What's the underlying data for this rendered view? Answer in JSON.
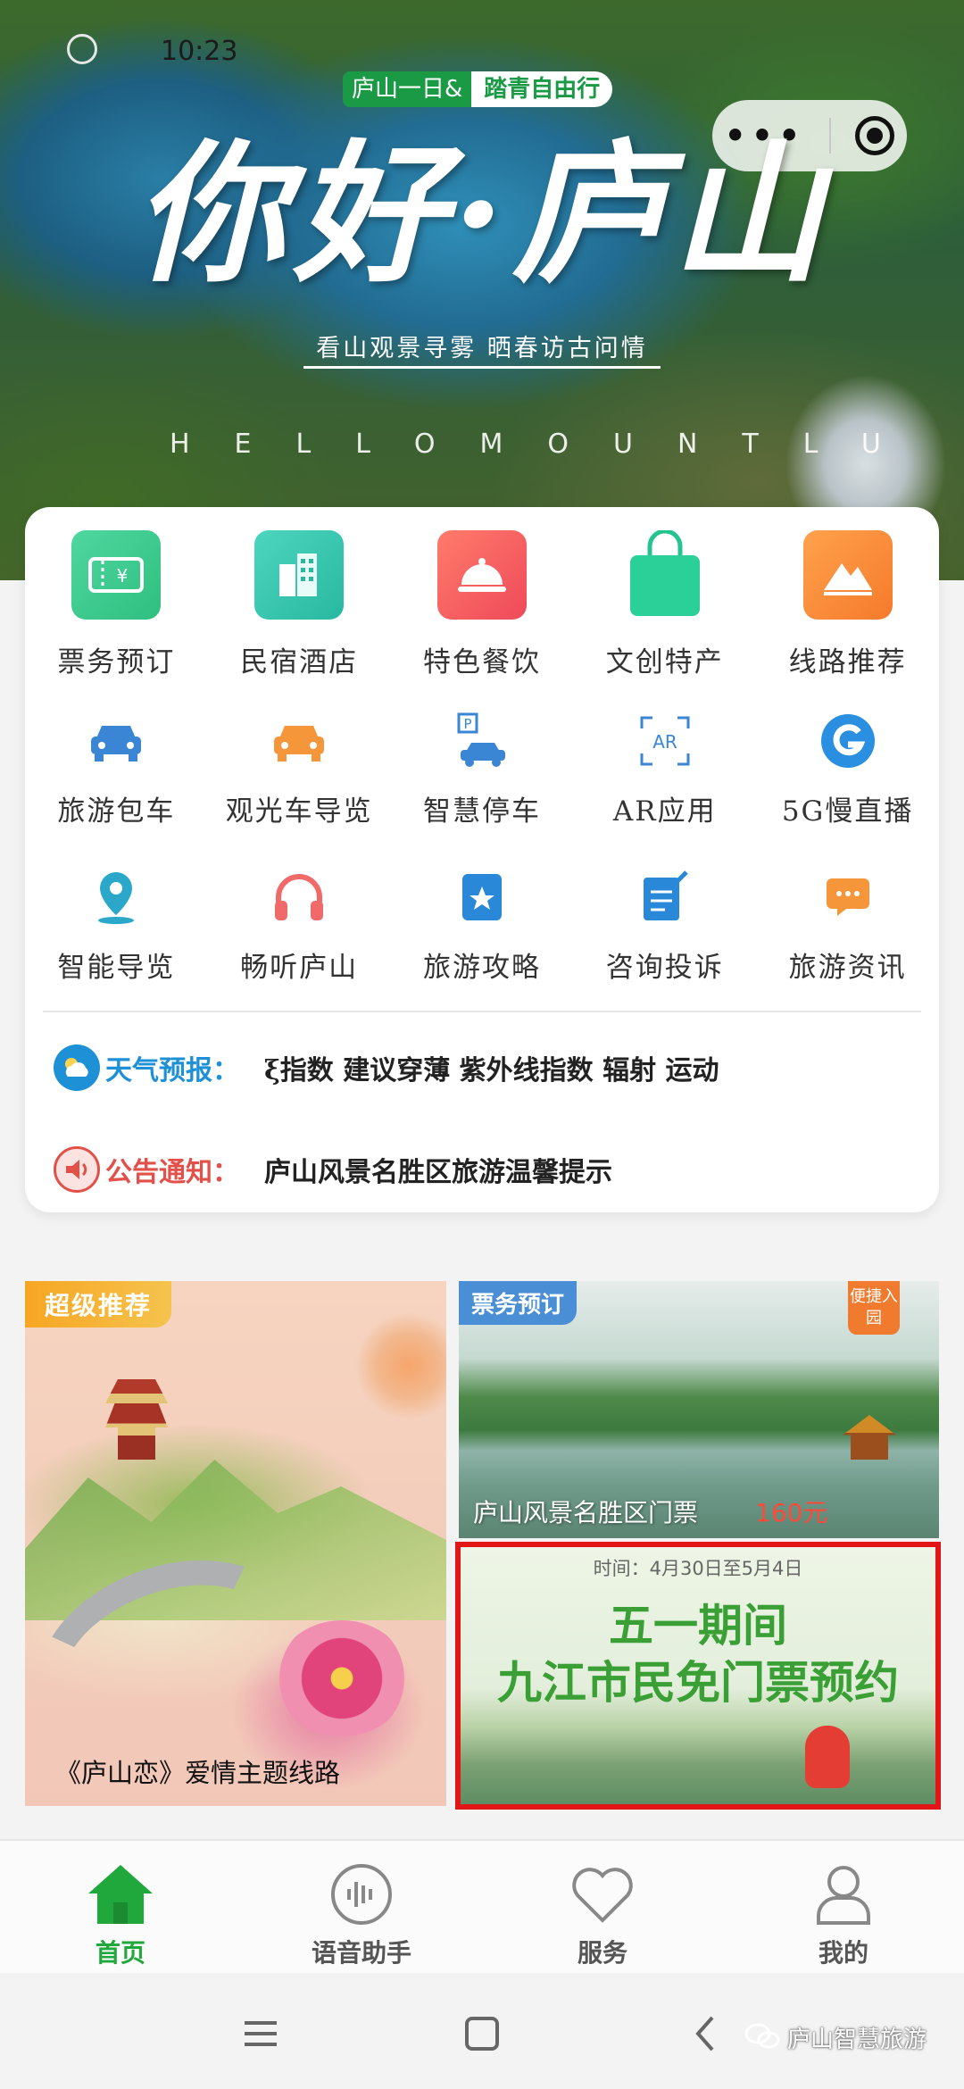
{
  "status_bar": {
    "time": "10:23"
  },
  "hero": {
    "tag_left": "庐山一日&",
    "tag_right": "踏青自由行",
    "title": "你好·庐山",
    "subtitle": "看山观景寻雾  晒春访古问情",
    "english": "HELLOMOUNTLU",
    "capsule": {
      "more_icon": "more-dots-icon",
      "close_icon": "target-close-icon"
    }
  },
  "menu": {
    "row1": [
      {
        "label": "票务预订",
        "icon": "ticket-icon",
        "color": "#35c88a"
      },
      {
        "label": "民宿酒店",
        "icon": "hotel-building-icon",
        "color": "#2ec4a6"
      },
      {
        "label": "特色餐饮",
        "icon": "dining-bell-icon",
        "color": "#f25b5b"
      },
      {
        "label": "文创特产",
        "icon": "shopping-bag-icon",
        "color": "#25c48e"
      },
      {
        "label": "线路推荐",
        "icon": "mountain-route-icon",
        "color": "#f78b3c"
      }
    ],
    "row2": [
      {
        "label": "旅游包车",
        "icon": "car-icon",
        "color": "#3a86d4"
      },
      {
        "label": "观光车导览",
        "icon": "tour-car-icon",
        "color": "#f5963b"
      },
      {
        "label": "智慧停车",
        "icon": "parking-icon",
        "color": "#3a86d4"
      },
      {
        "label": "AR应用",
        "icon": "ar-icon",
        "color": "#3a86d4"
      },
      {
        "label": "5G慢直播",
        "icon": "5g-icon",
        "color": "#2a8fe0"
      }
    ],
    "row3": [
      {
        "label": "智能导览",
        "icon": "location-pin-icon",
        "color": "#2aa7c9"
      },
      {
        "label": "畅听庐山",
        "icon": "headphones-icon",
        "color": "#f06a6a"
      },
      {
        "label": "旅游攻略",
        "icon": "guide-book-icon",
        "color": "#2a88d8"
      },
      {
        "label": "咨询投诉",
        "icon": "feedback-note-icon",
        "color": "#2a88d8"
      },
      {
        "label": "旅游资讯",
        "icon": "message-icon",
        "color": "#f5963b"
      }
    ]
  },
  "weather": {
    "label": "天气预报：",
    "text": "ξ指数  建议穿薄  紫外线指数  辐射    运动",
    "icon": "weather-cloud-icon",
    "color": "#1e90d6"
  },
  "notice": {
    "label": "公告通知：",
    "text": "庐山风景名胜区旅游温馨提示",
    "icon": "speaker-icon",
    "color": "#e2504a"
  },
  "promos": {
    "left": {
      "tag": "超级推荐",
      "caption": "《庐山恋》爱情主题线路"
    },
    "right_top": {
      "tag": "票务预订",
      "badge": "便捷入园",
      "name": "庐山风景名胜区门票",
      "price": "160元"
    },
    "right_bottom": {
      "date": "时间：4月30日至5月4日",
      "title_line1": "五一期间",
      "title_line2": "九江市民免门票预约"
    }
  },
  "tabbar": [
    {
      "label": "首页",
      "icon": "home-icon",
      "active": true
    },
    {
      "label": "语音助手",
      "icon": "voice-assistant-icon",
      "active": false
    },
    {
      "label": "服务",
      "icon": "heart-service-icon",
      "active": false
    },
    {
      "label": "我的",
      "icon": "user-profile-icon",
      "active": false
    }
  ],
  "watermark": {
    "text": "庐山智慧旅游",
    "icon": "wechat-icon"
  },
  "colors": {
    "accent_green": "#21a83c",
    "highlight_red": "#e21616"
  }
}
